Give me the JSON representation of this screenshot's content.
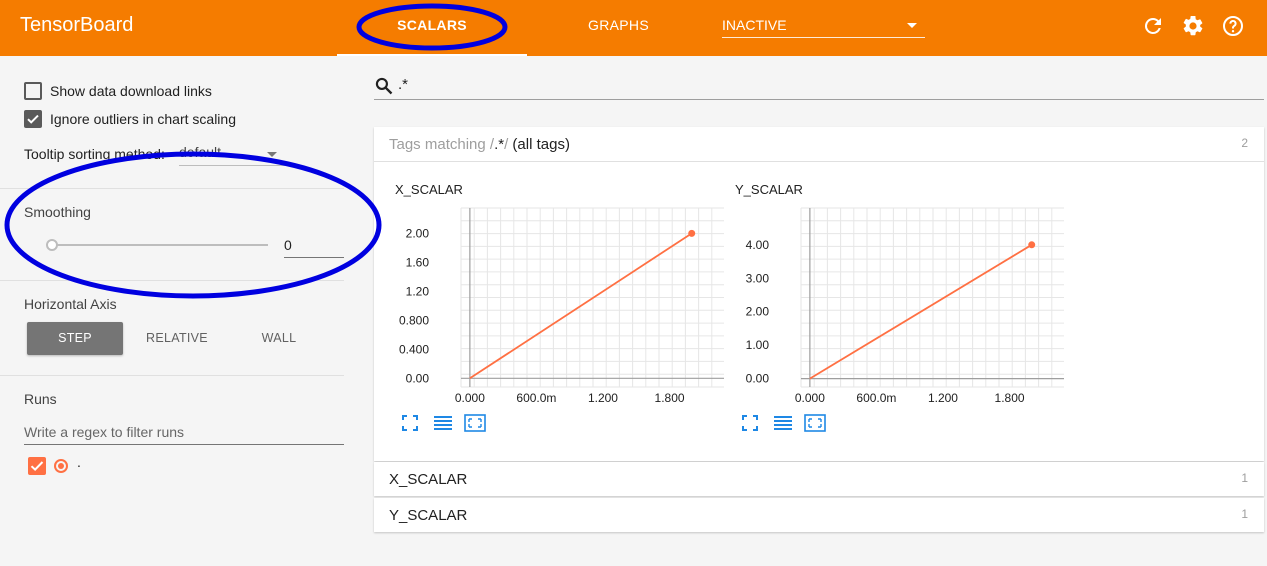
{
  "header": {
    "title": "TensorBoard",
    "tabs": [
      {
        "label": "SCALARS",
        "active": true
      },
      {
        "label": "GRAPHS",
        "active": false
      }
    ],
    "inactive_select": "INACTIVE",
    "icons": [
      "refresh-icon",
      "settings-icon",
      "help-icon"
    ],
    "accent": "#f57c00"
  },
  "sidebar": {
    "show_download_links": {
      "label": "Show data download links",
      "checked": false
    },
    "ignore_outliers": {
      "label": "Ignore outliers in chart scaling",
      "checked": true
    },
    "tooltip_sorting": {
      "label": "Tooltip sorting method:",
      "value": "default"
    },
    "smoothing": {
      "title": "Smoothing",
      "value": "0"
    },
    "horizontal_axis": {
      "title": "Horizontal Axis",
      "options": [
        "STEP",
        "RELATIVE",
        "WALL"
      ],
      "selected": "STEP"
    },
    "runs": {
      "title": "Runs",
      "filter_placeholder": "Write a regex to filter runs",
      "items": [
        {
          "label": ".",
          "checked": true,
          "color": "#ff7043"
        }
      ]
    }
  },
  "main": {
    "search": {
      "value": ".*"
    },
    "tags_card": {
      "prefix": "Tags matching /",
      "pattern": ".*",
      "suffix": "/",
      "all_tags": "(all tags)",
      "count": "2"
    },
    "groups": [
      {
        "name": "X_SCALAR",
        "count": "1"
      },
      {
        "name": "Y_SCALAR",
        "count": "1"
      }
    ]
  },
  "chart_data": [
    {
      "type": "line",
      "title": "X_SCALAR",
      "series": [
        {
          "x": [
            0,
            2
          ],
          "y": [
            0,
            2
          ],
          "color": "#ff7043"
        }
      ],
      "x_ticks": [
        "0.000",
        "600.0m",
        "1.200",
        "1.800"
      ],
      "y_ticks": [
        "0.00",
        "0.400",
        "0.800",
        "1.20",
        "1.60",
        "2.00"
      ],
      "xlim": [
        -0.08,
        2.3
      ],
      "ylim": [
        -0.12,
        2.35
      ],
      "grid": true
    },
    {
      "type": "line",
      "title": "Y_SCALAR",
      "series": [
        {
          "x": [
            0,
            2
          ],
          "y": [
            0,
            4
          ],
          "color": "#ff7043"
        }
      ],
      "x_ticks": [
        "0.000",
        "600.0m",
        "1.200",
        "1.800"
      ],
      "y_ticks": [
        "0.00",
        "1.00",
        "2.00",
        "3.00",
        "4.00"
      ],
      "xlim": [
        -0.08,
        2.3
      ],
      "ylim": [
        -0.25,
        5.1
      ],
      "grid": true
    }
  ],
  "annotations": {
    "color": "#0000e0"
  }
}
